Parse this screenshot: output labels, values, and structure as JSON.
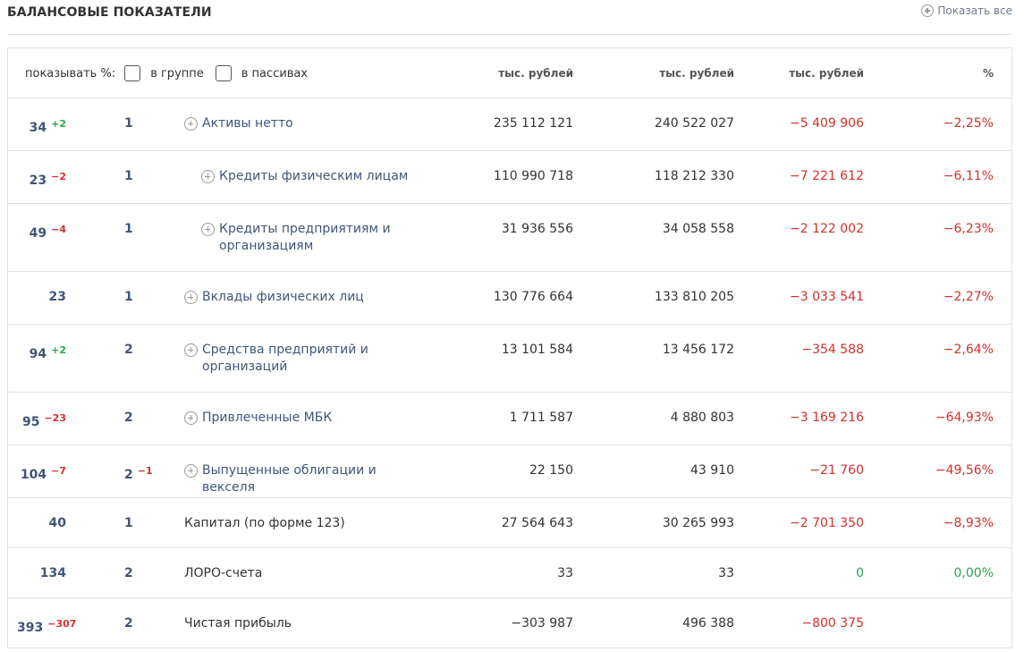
{
  "header": {
    "title": "БАЛАНСОВЫЕ ПОКАЗАТЕЛИ",
    "show_all": "Показать все"
  },
  "options": {
    "show_percent_label": "показывать %:",
    "in_group_label": "в группе",
    "in_liabilities_label": "в пассивах",
    "in_group_checked": false,
    "in_liabilities_checked": false
  },
  "columns": [
    "тыс. рублей",
    "тыс. рублей",
    "тыс. рублей",
    "%"
  ],
  "rows": [
    {
      "rank": "34",
      "rank_delta": "+2",
      "group": "1",
      "group_delta": "",
      "name": "Активы нетто",
      "expandable": true,
      "indent": false,
      "v1": "235 112 121",
      "v2": "240 522 027",
      "v3": "−5 409 906",
      "v4": "−2,25%"
    },
    {
      "rank": "23",
      "rank_delta": "−2",
      "group": "1",
      "group_delta": "",
      "name": "Кредиты физическим лицам",
      "expandable": true,
      "indent": true,
      "v1": "110 990 718",
      "v2": "118 212 330",
      "v3": "−7 221 612",
      "v4": "−6,11%"
    },
    {
      "rank": "49",
      "rank_delta": "−4",
      "group": "1",
      "group_delta": "",
      "name": "Кредиты предприятиям и организациям",
      "expandable": true,
      "indent": true,
      "v1": "31 936 556",
      "v2": "34 058 558",
      "v3": "−2 122 002",
      "v4": "−6,23%"
    },
    {
      "rank": "23",
      "rank_delta": "",
      "group": "1",
      "group_delta": "",
      "name": "Вклады физических лиц",
      "expandable": true,
      "indent": false,
      "v1": "130 776 664",
      "v2": "133 810 205",
      "v3": "−3 033 541",
      "v4": "−2,27%"
    },
    {
      "rank": "94",
      "rank_delta": "+2",
      "group": "2",
      "group_delta": "",
      "name": "Средства предприятий и организаций",
      "expandable": true,
      "indent": false,
      "v1": "13 101 584",
      "v2": "13 456 172",
      "v3": "−354 588",
      "v4": "−2,64%"
    },
    {
      "rank": "95",
      "rank_delta": "−23",
      "group": "2",
      "group_delta": "",
      "name": "Привлеченные МБК",
      "expandable": true,
      "indent": false,
      "v1": "1 711 587",
      "v2": "4 880 803",
      "v3": "−3 169 216",
      "v4": "−64,93%"
    },
    {
      "rank": "104",
      "rank_delta": "−7",
      "group": "2",
      "group_delta": "−1",
      "name": "Выпущенные облигации и векселя",
      "expandable": true,
      "indent": false,
      "v1": "22 150",
      "v2": "43 910",
      "v3": "−21 760",
      "v4": "−49,56%"
    },
    {
      "rank": "40",
      "rank_delta": "",
      "group": "1",
      "group_delta": "",
      "name": "Капитал (по форме 123)",
      "expandable": false,
      "indent": false,
      "v1": "27 564 643",
      "v2": "30 265 993",
      "v3": "−2 701 350",
      "v4": "−8,93%"
    },
    {
      "rank": "134",
      "rank_delta": "",
      "group": "2",
      "group_delta": "",
      "name": "ЛОРО-счета",
      "expandable": false,
      "indent": false,
      "v1": "33",
      "v2": "33",
      "v3": "0",
      "v4": "0,00%"
    },
    {
      "rank": "393",
      "rank_delta": "−307",
      "group": "2",
      "group_delta": "",
      "name": "Чистая прибыль",
      "expandable": false,
      "indent": false,
      "v1": "−303 987",
      "v2": "496 388",
      "v3": "−800 375",
      "v4": ""
    }
  ],
  "colors": {
    "link": "#3f5678",
    "negative": "#d0312d",
    "positive": "#2ea44f",
    "border": "#e2e2e2"
  }
}
